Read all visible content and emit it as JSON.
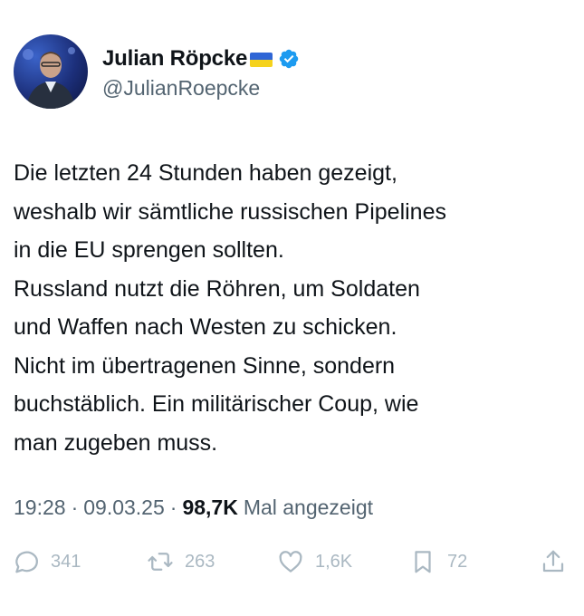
{
  "author": {
    "display_name": "Julian Röpcke",
    "handle": "@JulianRoepcke",
    "flag_colors": {
      "top": "#2f66d6",
      "bottom": "#f5d21d"
    },
    "verified_color": "#1d9bf0"
  },
  "tweet": {
    "lines": [
      "Die letzten 24 Stunden haben gezeigt,",
      "weshalb wir sämtliche russischen Pipelines",
      "in die EU sprengen sollten.",
      "Russland nutzt die Röhren, um Soldaten",
      "und Waffen nach Westen zu schicken.",
      "Nicht im übertragenen Sinne, sondern",
      "buchstäblich. Ein militärischer Coup, wie",
      "man zugeben muss."
    ]
  },
  "meta": {
    "time": "19:28",
    "separator": "·",
    "date": "09.03.25",
    "views_count": "98,7K",
    "views_label": "Mal angezeigt"
  },
  "actions": {
    "replies": {
      "icon": "reply-icon",
      "count": "341"
    },
    "reposts": {
      "icon": "repost-icon",
      "count": "263"
    },
    "likes": {
      "icon": "like-icon",
      "count": "1,6K"
    },
    "bookmarks": {
      "icon": "bookmark-icon",
      "count": "72"
    },
    "share": {
      "icon": "share-icon"
    }
  }
}
